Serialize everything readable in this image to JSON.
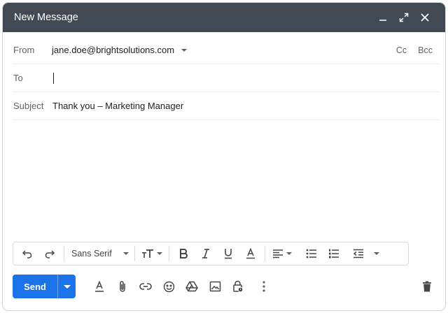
{
  "window": {
    "title": "New Message"
  },
  "from": {
    "label": "From",
    "value": "jane.doe@brightsolutions.com",
    "cc_label": "Cc",
    "bcc_label": "Bcc"
  },
  "to": {
    "label": "To",
    "value": ""
  },
  "subject": {
    "label": "Subject",
    "value": "Thank you – Marketing Manager"
  },
  "format_toolbar": {
    "font_family": "Sans Serif"
  },
  "send": {
    "label": "Send"
  },
  "colors": {
    "titlebar": "#404954",
    "send": "#1a73e8"
  }
}
